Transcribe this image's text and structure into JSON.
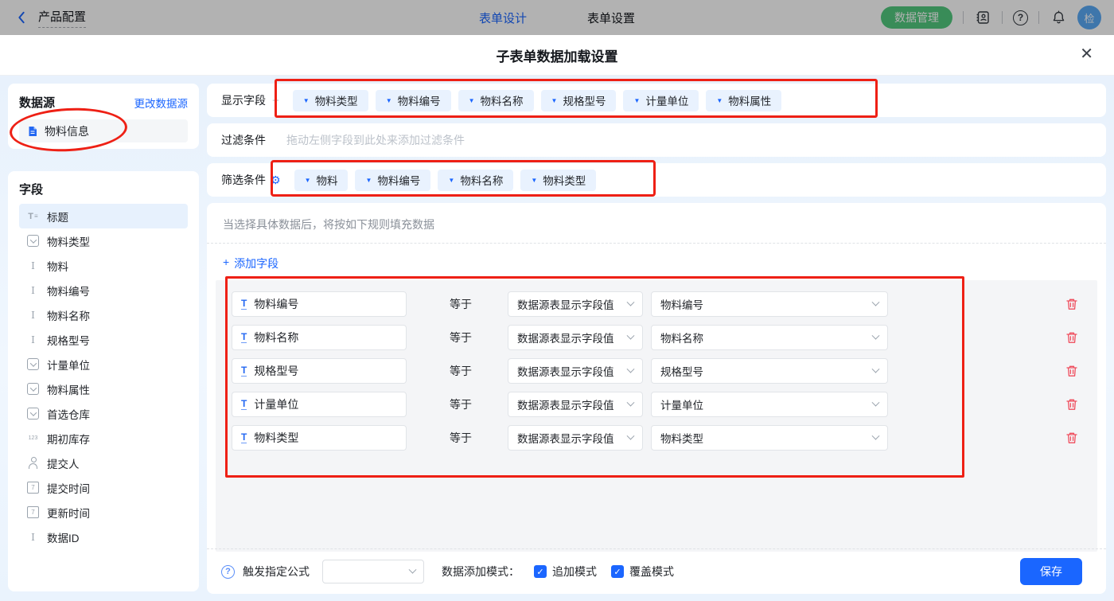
{
  "header": {
    "back_label": "产品配置",
    "tabs": [
      {
        "label": "表单设计",
        "active": true
      },
      {
        "label": "表单设置",
        "active": false
      }
    ],
    "data_manage_button": "数据管理",
    "avatar_text": "检"
  },
  "modal": {
    "title": "子表单数据加载设置",
    "close_glyph": "✕"
  },
  "datasource": {
    "title": "数据源",
    "change_link": "更改数据源",
    "item": "物料信息"
  },
  "fields_panel": {
    "title": "字段",
    "items": [
      {
        "label": "标题",
        "icon": "title",
        "state": "active"
      },
      {
        "label": "物料类型",
        "icon": "select"
      },
      {
        "label": "物料",
        "icon": "text"
      },
      {
        "label": "物料编号",
        "icon": "text"
      },
      {
        "label": "物料名称",
        "icon": "text"
      },
      {
        "label": "规格型号",
        "icon": "text"
      },
      {
        "label": "计量单位",
        "icon": "select"
      },
      {
        "label": "物料属性",
        "icon": "select"
      },
      {
        "label": "首选仓库",
        "icon": "select"
      },
      {
        "label": "期初库存",
        "icon": "number"
      },
      {
        "label": "提交人",
        "icon": "person"
      },
      {
        "label": "提交时间",
        "icon": "date"
      },
      {
        "label": "更新时间",
        "icon": "date"
      },
      {
        "label": "数据ID",
        "icon": "text"
      }
    ]
  },
  "display_fields": {
    "label": "显示字段",
    "tags": [
      "物料类型",
      "物料编号",
      "物料名称",
      "规格型号",
      "计量单位",
      "物料属性"
    ]
  },
  "filter": {
    "label": "过滤条件",
    "placeholder": "拖动左侧字段到此处来添加过滤条件"
  },
  "screen": {
    "label": "筛选条件",
    "tags": [
      "物料",
      "物料编号",
      "物料名称",
      "物料类型"
    ]
  },
  "rules": {
    "hint": "当选择具体数据后，将按如下规则填充数据",
    "add_field_label": "添加字段",
    "equals_label": "等于",
    "rows": [
      {
        "field": "物料编号",
        "source": "数据源表显示字段值",
        "target": "物料编号"
      },
      {
        "field": "物料名称",
        "source": "数据源表显示字段值",
        "target": "物料名称"
      },
      {
        "field": "规格型号",
        "source": "数据源表显示字段值",
        "target": "规格型号"
      },
      {
        "field": "计量单位",
        "source": "数据源表显示字段值",
        "target": "计量单位"
      },
      {
        "field": "物料类型",
        "source": "数据源表显示字段值",
        "target": "物料类型"
      }
    ]
  },
  "footer": {
    "formula_label": "触发指定公式",
    "mode_label": "数据添加模式：",
    "modes": [
      {
        "label": "追加模式",
        "checked": true
      },
      {
        "label": "覆盖模式",
        "checked": true
      }
    ],
    "save_label": "保存"
  },
  "colors": {
    "accent_blue": "#1b66ff",
    "annotation_red": "#ee2015",
    "save_button": "#1a66ff",
    "green_button": "#52c97e",
    "trash_red": "#ef4d5d",
    "tag_bg": "#e9f2fe",
    "panel_gray": "#f4f5f7",
    "content_bg": "#e8f1fc"
  }
}
